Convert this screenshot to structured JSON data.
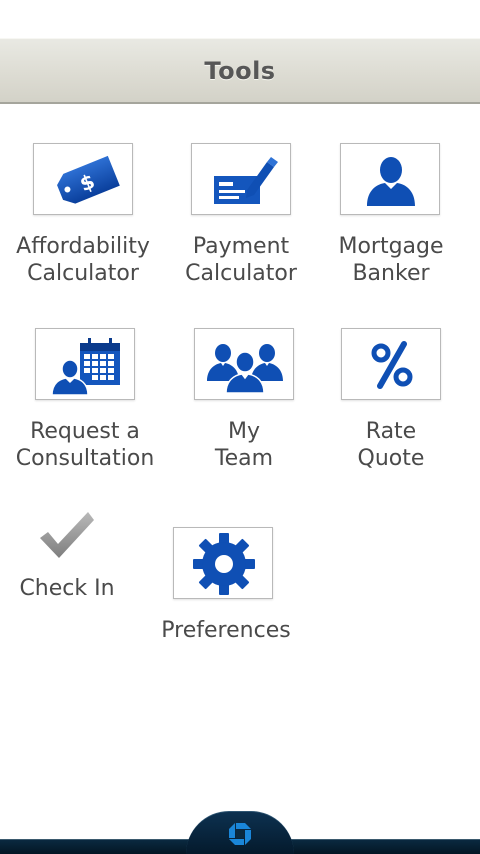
{
  "header": {
    "title": "Tools"
  },
  "tools": [
    {
      "id": "affordability-calculator",
      "icon": "price-tag-dollar-icon",
      "line1": "Affordability",
      "line2": "Calculator"
    },
    {
      "id": "payment-calculator",
      "icon": "check-pen-icon",
      "line1": "Payment",
      "line2": "Calculator"
    },
    {
      "id": "mortgage-banker",
      "icon": "person-icon",
      "line1": "Mortgage",
      "line2": "Banker"
    },
    {
      "id": "request-consultation",
      "icon": "person-calendar-icon",
      "line1": "Request a",
      "line2": "Consultation"
    },
    {
      "id": "my-team",
      "icon": "group-icon",
      "line1": "My",
      "line2": "Team"
    },
    {
      "id": "rate-quote",
      "icon": "percent-icon",
      "line1": "Rate",
      "line2": "Quote"
    },
    {
      "id": "check-in",
      "icon": "checkmark-icon",
      "line1": "Check In"
    },
    {
      "id": "preferences",
      "icon": "gear-icon",
      "line1": "Preferences"
    }
  ],
  "bottom_nav": {
    "icon": "chase-logo-icon"
  },
  "colors": {
    "accent": "#0f4fb4",
    "accent_dark": "#0a3a8c",
    "header_bg": "#dddcd3",
    "label": "#4a4a4a",
    "check_gray": "#8e8e8e"
  }
}
